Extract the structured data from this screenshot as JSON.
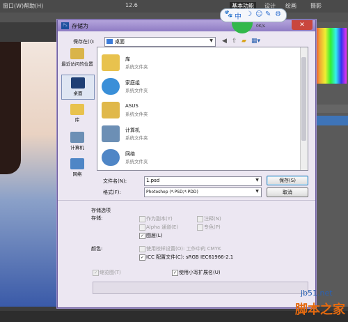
{
  "app": {
    "menu": [
      "窗口(W)",
      "帮助(H)"
    ],
    "zoom": "12.6",
    "workspace_tabs": [
      "基本功能",
      "设计",
      "绘画",
      "摄影"
    ]
  },
  "toolbar_pill": {
    "icons": [
      "paw-icon",
      "chinese-input-icon",
      "moon-icon",
      "smiley-icon",
      "pen-icon",
      "gear-icon"
    ],
    "glyphs": [
      "🐾",
      "中",
      "☽",
      "☺",
      "✎",
      "⚙"
    ]
  },
  "download_speed": "0K/s",
  "dialog": {
    "title": "存储为",
    "save_in_label": "保存在(I):",
    "save_in_value": "桌面",
    "places": [
      {
        "label": "最近访问的位置",
        "icon": "recent-places-icon"
      },
      {
        "label": "桌面",
        "icon": "desktop-icon"
      },
      {
        "label": "库",
        "icon": "libraries-icon"
      },
      {
        "label": "计算机",
        "icon": "computer-icon"
      },
      {
        "label": "网络",
        "icon": "network-icon"
      }
    ],
    "files": [
      {
        "name": "库",
        "desc": "系统文件夹",
        "icon": "library-folder-icon",
        "color": "#e8c24e"
      },
      {
        "name": "家庭组",
        "desc": "系统文件夹",
        "icon": "homegroup-icon",
        "color": "#3a8fd8"
      },
      {
        "name": "ASUS",
        "desc": "系统文件夹",
        "icon": "user-folder-icon",
        "color": "#e0b84a"
      },
      {
        "name": "计算机",
        "desc": "系统文件夹",
        "icon": "computer-icon",
        "color": "#6c8fb5"
      },
      {
        "name": "网络",
        "desc": "系统文件夹",
        "icon": "network-icon",
        "color": "#4f86c6"
      }
    ],
    "filename_label": "文件名(N):",
    "filename_value": "1.psd",
    "format_label": "格式(F):",
    "format_value": "Photoshop (*.PSD;*.PDD)",
    "save_button": "保存(S)",
    "cancel_button": "取消",
    "options": {
      "section_title": "存储选项",
      "storage_label": "存储:",
      "as_copy": "作为副本(Y)",
      "annotations": "注释(N)",
      "alpha": "Alpha 通道(E)",
      "spot": "专色(P)",
      "layers": "图层(L)",
      "color_label": "颜色:",
      "use_proof": "使用校样设置(O): 工作中的 CMYK",
      "icc": "ICC 配置文件(C): sRGB IEC61966-2.1",
      "thumbnail": "缩览图(T)",
      "lowercase_ext": "使用小写扩展名(U)"
    }
  },
  "watermark": {
    "line1": "jb51.net",
    "line2": "脚本之家"
  }
}
